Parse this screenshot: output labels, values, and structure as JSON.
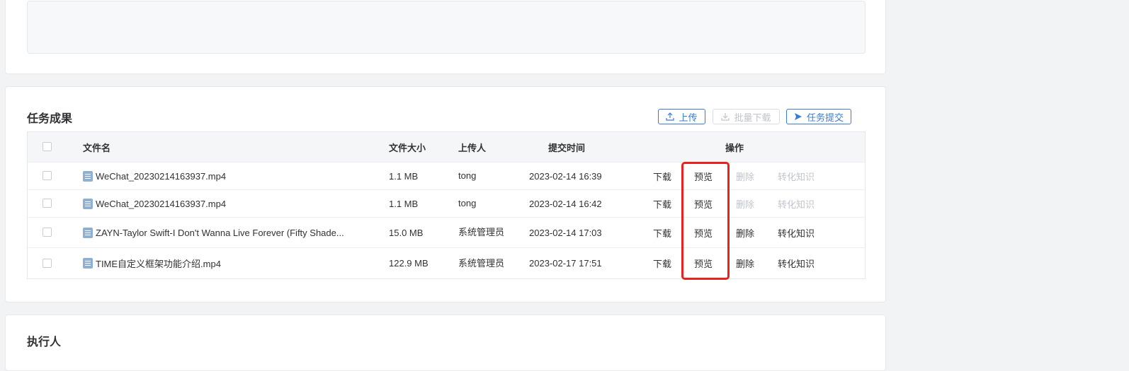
{
  "task_results": {
    "title": "任务成果",
    "buttons": {
      "upload": "上传",
      "batch_download": "批量下载",
      "submit": "任务提交"
    },
    "columns": {
      "filename": "文件名",
      "size": "文件大小",
      "uploader": "上传人",
      "time": "提交时间",
      "actions": "操作"
    },
    "rows": [
      {
        "name": "WeChat_20230214163937.mp4",
        "size": "1.1 MB",
        "uploader": "tong",
        "time": "2023-02-14 16:39",
        "download": "下载",
        "preview": "预览",
        "delete": "删除",
        "convert": "转化知识"
      },
      {
        "name": "WeChat_20230214163937.mp4",
        "size": "1.1 MB",
        "uploader": "tong",
        "time": "2023-02-14 16:42",
        "download": "下载",
        "preview": "预览",
        "delete": "删除",
        "convert": "转化知识"
      },
      {
        "name": "ZAYN-Taylor Swift-I Don't Wanna Live Forever (Fifty Shade...",
        "size": "15.0 MB",
        "uploader": "系统管理员",
        "time": "2023-02-14 17:03",
        "download": "下载",
        "preview": "预览",
        "delete": "删除",
        "convert": "转化知识"
      },
      {
        "name": "TIME自定义框架功能介绍.mp4",
        "size": "122.9 MB",
        "uploader": "系统管理员",
        "time": "2023-02-17 17:51",
        "download": "下载",
        "preview": "预览",
        "delete": "删除",
        "convert": "转化知识"
      }
    ]
  },
  "executor": {
    "title": "执行人"
  },
  "colors": {
    "primary": "#3a7bd5",
    "highlight": "#e8231f",
    "disabled": "#c0c4cc"
  }
}
